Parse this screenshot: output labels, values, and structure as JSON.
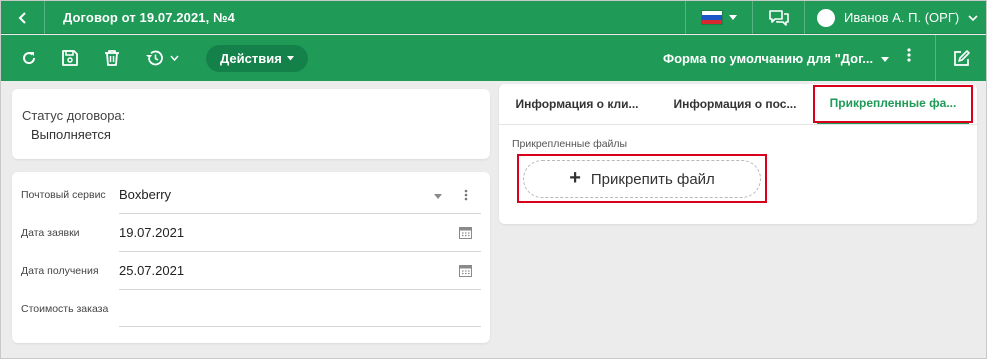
{
  "header": {
    "title": "Договор от 19.07.2021, №4",
    "user_name": "Иванов А. П. (ОРГ)",
    "flag_colors": [
      "#ffffff",
      "#1c57c7",
      "#d8282f"
    ]
  },
  "toolbar": {
    "actions_label": "Действия",
    "form_selector": "Форма по умолчанию для \"Дог..."
  },
  "status": {
    "label": "Статус договора:",
    "value": "Выполняется"
  },
  "fields": [
    {
      "label": "Почтовый сервис",
      "value": "Boxberry"
    },
    {
      "label": "Дата заявки",
      "value": "19.07.2021"
    },
    {
      "label": "Дата получения",
      "value": "25.07.2021"
    },
    {
      "label": "Стоимость заказа",
      "value": ""
    }
  ],
  "tabs": [
    {
      "label": "Информация о кли..."
    },
    {
      "label": "Информация о пос..."
    },
    {
      "label": "Прикрепленные фа..."
    }
  ],
  "attachments": {
    "section_label": "Прикрепленные файлы",
    "attach_button": "Прикрепить файл"
  },
  "colors": {
    "brand": "#1f9a57",
    "highlight": "#d9001b"
  }
}
